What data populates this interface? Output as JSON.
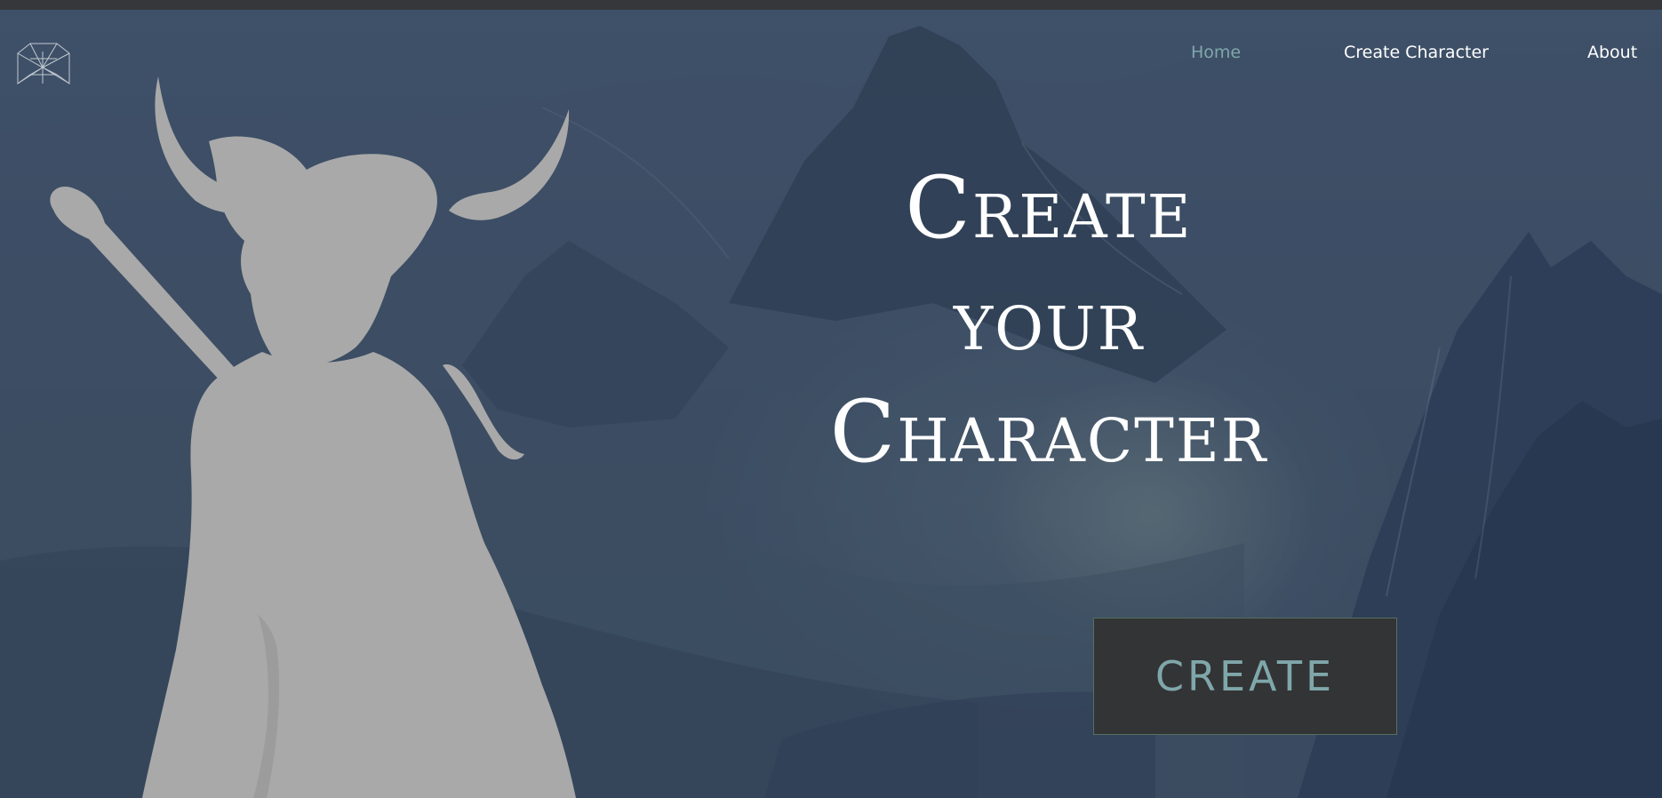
{
  "nav": {
    "home_label": "Home",
    "create_character_label": "Create Character",
    "about_label": "About",
    "active_item": "Home"
  },
  "hero": {
    "headline_lines": [
      "Create",
      "your",
      "Character"
    ],
    "cta_label": "CREATE"
  },
  "colors": {
    "nav_active": "#7fa7aa",
    "nav_text": "#ffffff",
    "button_bg": "#333435",
    "button_text": "#7fa7aa",
    "silhouette": "#a9a9a9"
  },
  "icons": {
    "logo": "geometric-wireframe-logo-icon"
  }
}
